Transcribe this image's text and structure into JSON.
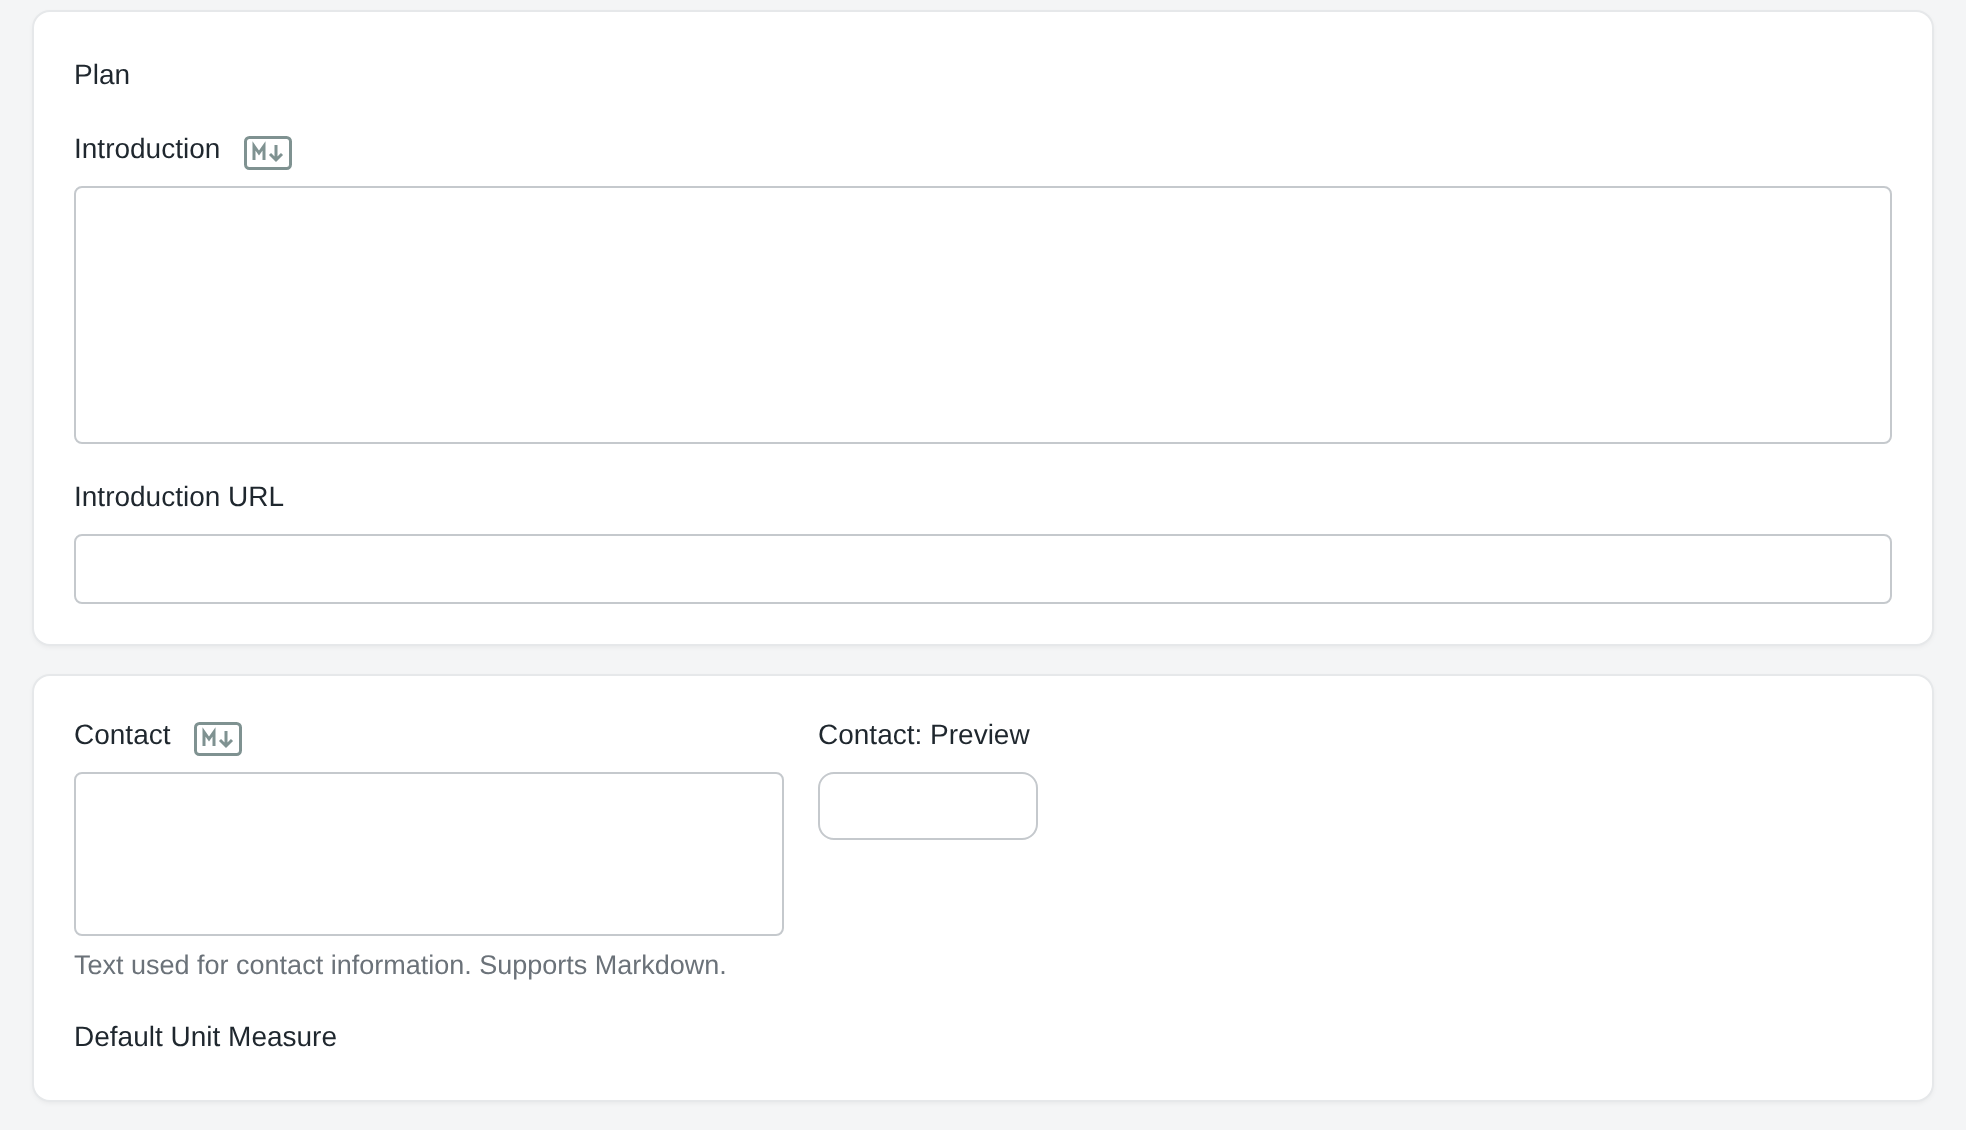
{
  "cards": [
    {
      "columns": [
        [
          {
            "kind": "heading",
            "label": "Plan"
          },
          {
            "kind": "textarea",
            "label": "Introduction",
            "markdown": true
          },
          {
            "kind": "input",
            "label": "Introduction URL"
          }
        ]
      ]
    },
    {
      "columns": [
        [
          {
            "kind": "textarea",
            "label": "Contact",
            "markdown": true,
            "help": "Text used for contact information. Supports Markdown."
          },
          {
            "kind": "label",
            "label": "Default Unit Measure"
          }
        ],
        [
          {
            "kind": "input",
            "label": "Contact: Preview"
          }
        ]
      ]
    }
  ]
}
